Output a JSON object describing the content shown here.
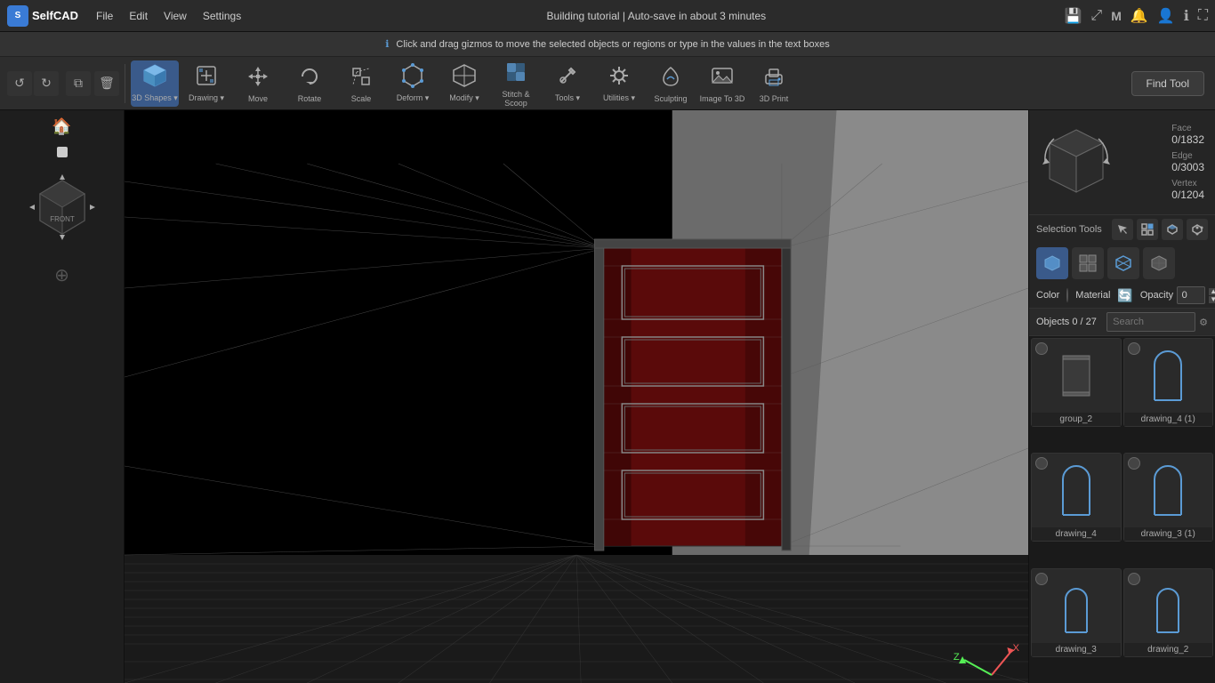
{
  "app": {
    "name": "SelfCAD",
    "logo_text": "S"
  },
  "topbar": {
    "menus": [
      "File",
      "Edit",
      "View",
      "Settings"
    ],
    "title": "Building tutorial",
    "autosave": "Auto-save in about 3 minutes",
    "separator": "|"
  },
  "notifbar": {
    "message": "Click and drag gizmos to move the selected objects or regions or type in the values in the text boxes"
  },
  "toolbar": {
    "undo_label": "↺",
    "redo_label": "↻",
    "copy_label": "⧉",
    "trash_label": "🗑",
    "tools": [
      {
        "id": "3d-shapes",
        "label": "3D Shapes",
        "icon": "⬡"
      },
      {
        "id": "drawing",
        "label": "Drawing",
        "icon": "✏"
      },
      {
        "id": "move",
        "label": "Move",
        "icon": "✥"
      },
      {
        "id": "rotate",
        "label": "Rotate",
        "icon": "↻"
      },
      {
        "id": "scale",
        "label": "Scale",
        "icon": "⤡"
      },
      {
        "id": "deform",
        "label": "Deform",
        "icon": "⬡"
      },
      {
        "id": "modify",
        "label": "Modify",
        "icon": "⬢"
      },
      {
        "id": "stitch-scoop",
        "label": "Stitch & Scoop",
        "icon": "⊕"
      },
      {
        "id": "tools",
        "label": "Tools",
        "icon": "🔧"
      },
      {
        "id": "utilities",
        "label": "Utilities",
        "icon": "⚙"
      },
      {
        "id": "sculpting",
        "label": "Sculpting",
        "icon": "✦"
      },
      {
        "id": "image-to-3d",
        "label": "Image To 3D",
        "icon": "🖼"
      },
      {
        "id": "3d-print",
        "label": "3D Print",
        "icon": "🖨"
      }
    ],
    "find_tool": "Find Tool"
  },
  "right_panel": {
    "face_label": "Face",
    "face_val": "0/1832",
    "edge_label": "Edge",
    "edge_val": "0/3003",
    "vertex_label": "Vertex",
    "vertex_val": "0/1204",
    "selection_tools_label": "Selection Tools",
    "color_label": "Color",
    "material_label": "Material",
    "opacity_label": "Opacity",
    "opacity_val": "0",
    "objects_label": "Objects 0 / 27",
    "search_placeholder": "Search",
    "objects": [
      {
        "id": "group_2",
        "label": "group_2",
        "type": "box"
      },
      {
        "id": "drawing_4_1",
        "label": "drawing_4 (1)",
        "type": "arch"
      },
      {
        "id": "drawing_4",
        "label": "drawing_4",
        "type": "arch"
      },
      {
        "id": "drawing_3_1",
        "label": "drawing_3 (1)",
        "type": "arch"
      },
      {
        "id": "drawing_3",
        "label": "drawing_3",
        "type": "arch-sm"
      },
      {
        "id": "drawing_2",
        "label": "drawing_2",
        "type": "arch-sm"
      }
    ]
  },
  "scene": {
    "axis_x": "X",
    "axis_z": "Z"
  }
}
